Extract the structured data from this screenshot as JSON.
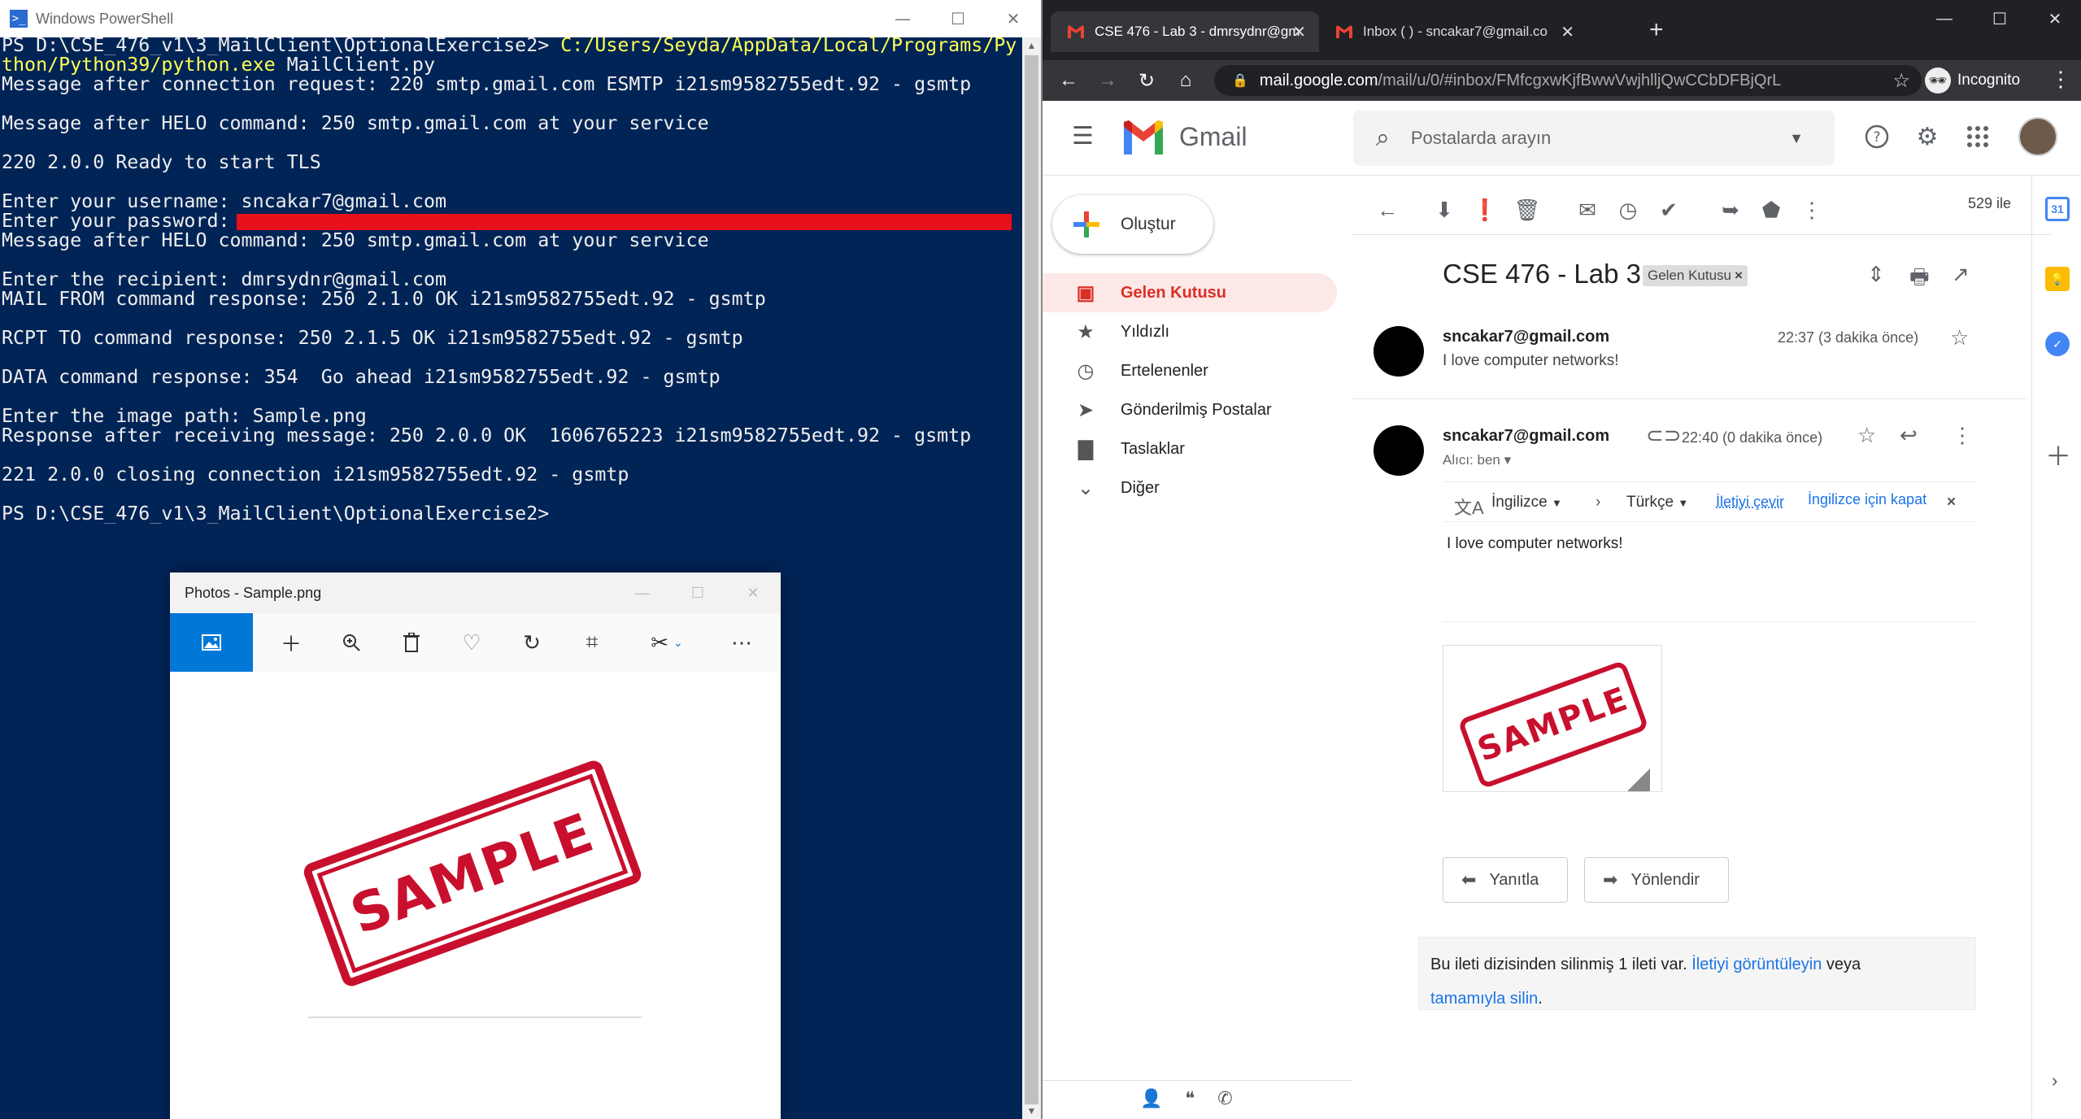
{
  "powershell": {
    "title": "Windows PowerShell",
    "window_buttons": [
      "—",
      "☐",
      "✕"
    ],
    "lines": [
      {
        "text": "PS D:\\CSE_476_v1\\3_MailClient\\OptionalExercise2> ",
        "yellow": "C:/Users/Seyda/AppData/Local/Programs/Py"
      },
      {
        "text": "",
        "yellow": "thon/Python39/python.exe",
        "after": " MailClient.py"
      },
      {
        "text": "Message after connection request: 220 smtp.gmail.com ESMTP i21sm9582755edt.92 - gsmtp"
      },
      {
        "text": ""
      },
      {
        "text": "Message after HELO command: 250 smtp.gmail.com at your service"
      },
      {
        "text": ""
      },
      {
        "text": "220 2.0.0 Ready to start TLS"
      },
      {
        "text": ""
      },
      {
        "text": "Enter your username: sncakar7@gmail.com"
      },
      {
        "text": "Enter your password: "
      },
      {
        "text": "Message after HELO command: 250 smtp.gmail.com at your service"
      },
      {
        "text": ""
      },
      {
        "text": "Enter the recipient: dmrsydnr@gmail.com"
      },
      {
        "text": "MAIL FROM command response: 250 2.1.0 OK i21sm9582755edt.92 - gsmtp"
      },
      {
        "text": ""
      },
      {
        "text": "RCPT TO command response: 250 2.1.5 OK i21sm9582755edt.92 - gsmtp"
      },
      {
        "text": ""
      },
      {
        "text": "DATA command response: 354  Go ahead i21sm9582755edt.92 - gsmtp"
      },
      {
        "text": ""
      },
      {
        "text": "Enter the image path: Sample.png"
      },
      {
        "text": "Response after receiving message: 250 2.0.0 OK  1606765223 i21sm9582755edt.92 - gsmtp"
      },
      {
        "text": ""
      },
      {
        "text": "221 2.0.0 closing connection i21sm9582755edt.92 - gsmtp"
      },
      {
        "text": ""
      },
      {
        "text": "PS D:\\CSE_476_v1\\3_MailClient\\OptionalExercise2>"
      }
    ]
  },
  "photos": {
    "title": "Photos - Sample.png",
    "window_buttons": [
      "—",
      "☐",
      "✕"
    ],
    "stamp_text": "SAMPLE",
    "tools": [
      "image-icon",
      "add-icon",
      "zoom-icon",
      "delete-icon",
      "favorite-icon",
      "rotate-icon",
      "crop-icon",
      "edit-icon",
      "more-icon"
    ]
  },
  "chrome": {
    "tabs": [
      {
        "title": "CSE 476 - Lab 3 - dmrsydnr@gm",
        "close": "✕"
      },
      {
        "title": "Inbox (      ) - sncakar7@gmail.co",
        "close": "✕"
      }
    ],
    "new_tab": "+",
    "window_buttons": [
      "—",
      "☐",
      "✕"
    ],
    "url_host": "mail.google.com",
    "url_rest": "/mail/u/0/#inbox/FMfcgxwKjfBwwVwjhlljQwCCbDFBjQrL",
    "incognito_label": "Incognito"
  },
  "gmail": {
    "logo_text": "Gmail",
    "search_placeholder": "Postalarda arayın",
    "compose_label": "Oluştur",
    "nav": [
      {
        "label": "Gelen Kutusu",
        "icon": "inbox-icon"
      },
      {
        "label": "Yıldızlı",
        "icon": "star-icon"
      },
      {
        "label": "Ertelenenler",
        "icon": "clock-icon"
      },
      {
        "label": "Gönderilmiş Postalar",
        "icon": "send-icon"
      },
      {
        "label": "Taslaklar",
        "icon": "draft-icon"
      },
      {
        "label": "Diğer",
        "icon": "chevron-down-icon"
      }
    ],
    "page_count": "529 ile",
    "subject": "CSE 476 - Lab 3",
    "label_chip": "Gelen Kutusu",
    "label_chip_close": "×",
    "messages": [
      {
        "sender": "sncakar7@gmail.com",
        "snippet": "I love computer networks!",
        "time": "22:37 (3 dakika önce)"
      },
      {
        "sender": "sncakar7@gmail.com",
        "to": "Alıcı: ben",
        "time": "22:40 (0 dakika önce)"
      }
    ],
    "translate": {
      "from": "İngilizce",
      "to": "Türkçe",
      "translate_link": "İletiyi çevir",
      "off_link": "İngilizce için kapat",
      "close": "×"
    },
    "body_text": "I love computer networks!",
    "attachment_stamp": "SAMPLE",
    "reply_label": "Yanıtla",
    "forward_label": "Yönlendir",
    "deleted_notice": {
      "text1": "Bu ileti dizisinden silinmiş 1 ileti var. ",
      "link1": "İletiyi görüntüleyin",
      "text2": " veya",
      "link2": "tamamıyla silin",
      "text3": "."
    },
    "calendar_day": "31"
  },
  "colors": {
    "ps_bg": "#012456",
    "ps_yellow": "#ffff54",
    "gmail_red": "#d93025",
    "link_blue": "#1a73e8",
    "redaction": "#e8101a"
  }
}
